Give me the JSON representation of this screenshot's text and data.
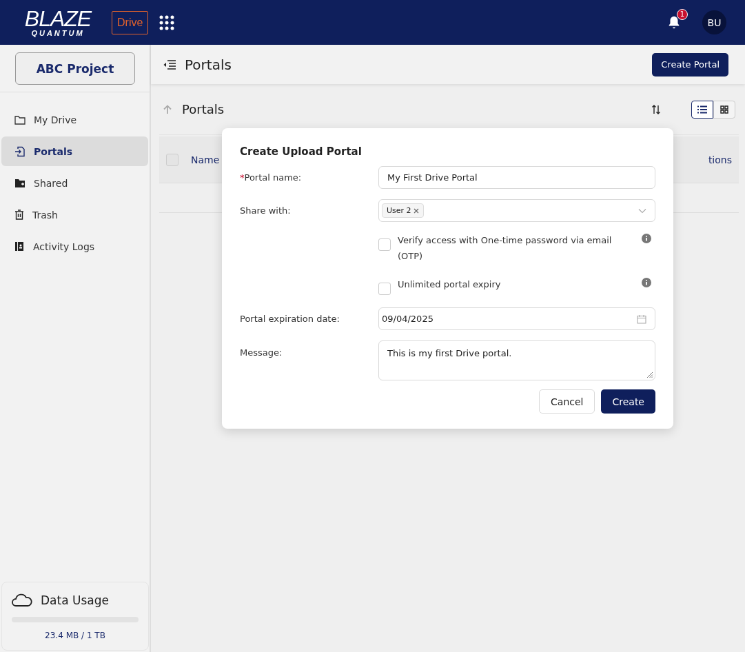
{
  "header": {
    "logo_top": "BLAZE",
    "logo_bottom": "QUANTUM",
    "app_badge": "Drive",
    "notification_count": "1",
    "avatar": "BU"
  },
  "sidebar": {
    "project": "ABC Project",
    "items": [
      {
        "label": "My Drive",
        "kind": "folder",
        "selected": false
      },
      {
        "label": "Portals",
        "kind": "portal",
        "selected": true
      },
      {
        "label": "Shared",
        "kind": "shared",
        "selected": false
      },
      {
        "label": "Trash",
        "kind": "trash",
        "selected": false
      },
      {
        "label": "Activity Logs",
        "kind": "logs",
        "selected": false
      }
    ],
    "data_usage": {
      "title": "Data Usage",
      "level": 0,
      "reading": "23.4 MB / 1 TB"
    }
  },
  "page": {
    "title": "Portals",
    "create_button": "Create Portal",
    "breadcrumb": "Portals",
    "views": [
      {
        "kind": "list",
        "selected": true
      },
      {
        "kind": "grid",
        "selected": false
      }
    ],
    "table": {
      "select_all_checked": false,
      "columns": [
        "Name",
        "tions"
      ]
    }
  },
  "dialog": {
    "title": "Create Upload Portal",
    "required_mark": "*",
    "name_label": "Portal name:",
    "name_value": "My First Drive Portal",
    "share_label": "Share with:",
    "share_tags": [
      "User 2"
    ],
    "options": [
      {
        "label": "Verify access with One-time password via email (OTP)",
        "checked": false
      },
      {
        "label": "Unlimited portal expiry",
        "checked": false
      }
    ],
    "date_label": "Portal expiration date:",
    "date_value": "09/04/2025",
    "message_label": "Message:",
    "message_value": "This is my first Drive portal.",
    "buttons": [
      "Cancel",
      "Create"
    ]
  }
}
